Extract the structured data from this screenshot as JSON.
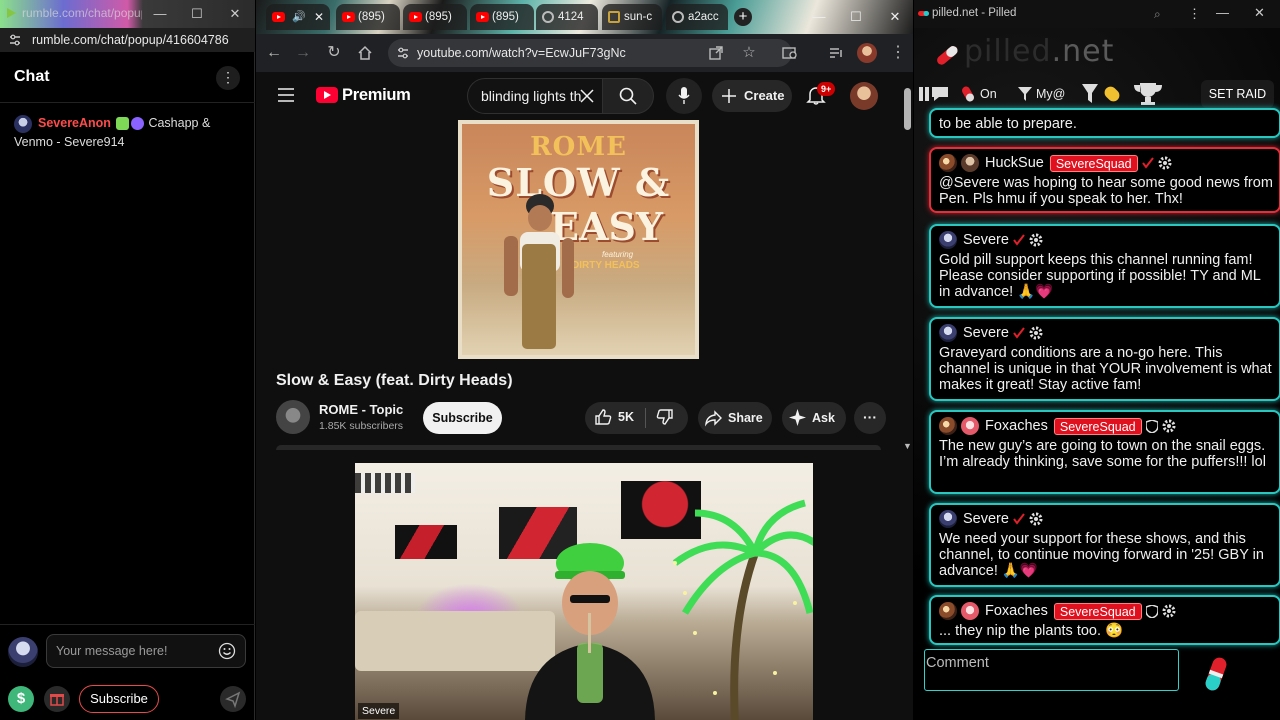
{
  "rumble": {
    "window_title": "rumble.com/chat/popup/41...",
    "url": "rumble.com/chat/popup/416604786",
    "chat_title": "Chat",
    "message": {
      "user": "SevereAnon",
      "text": "Cashapp & Venmo - Severe914"
    },
    "input_placeholder": "Your message here!",
    "subscribe_label": "Subscribe"
  },
  "chrome": {
    "tabs": [
      {
        "label": ""
      },
      {
        "label": "(895)"
      },
      {
        "label": "(895)"
      },
      {
        "label": "(895)"
      },
      {
        "label": "4124"
      },
      {
        "label": "sun-c"
      },
      {
        "label": "a2acc"
      }
    ],
    "url": "youtube.com/watch?v=EcwJuF73gNc",
    "youtube": {
      "brand": "Premium",
      "search_value": "blinding lights th",
      "create_label": "Create",
      "notification_count": "9+",
      "album": {
        "artist": "ROME",
        "line1": "SLOW &",
        "line2": "EASY",
        "featuring": "featuring",
        "feat_artist": "DIRTY HEADS"
      },
      "video_title": "Slow & Easy (feat. Dirty Heads)",
      "channel_name": "ROME - Topic",
      "subscriber_count": "1.85K subscribers",
      "subscribe_label": "Subscribe",
      "like_count": "5K",
      "share_label": "Share",
      "ask_label": "Ask"
    },
    "webcam_label": "Severe"
  },
  "pilled": {
    "window_title": "pilled.net - Pilled",
    "logo": {
      "main": "pilled",
      "tld": ".net"
    },
    "toolbar": {
      "toggle_label": "On",
      "filter_label": "My@",
      "raid_label": "SET RAID"
    },
    "messages": [
      {
        "user": "",
        "text": "to be able to prepare.",
        "partial": true
      },
      {
        "user": "HuckSue",
        "badge": "SevereSquad",
        "text": "@Severe was hoping to hear some good news from Pen. Pls hmu if you speak to her. Thx!",
        "color": "red"
      },
      {
        "user": "Severe",
        "text": "Gold pill support keeps this channel running fam! Please consider supporting if possible! TY and ML in advance! 🙏💗"
      },
      {
        "user": "Severe",
        "text": "Graveyard conditions are a no-go here. This channel is unique in that YOUR involvement is what makes it great! Stay active fam!"
      },
      {
        "user": "Foxaches",
        "badge": "SevereSquad",
        "text": "The new guy’s are going to town on the snail eggs. I’m already thinking, save some for the puffers!!! lol"
      },
      {
        "user": "Severe",
        "text": "We need your support for these shows, and this channel, to continue moving forward in '25! GBY in advance! 🙏💗"
      },
      {
        "user": "Foxaches",
        "badge": "SevereSquad",
        "text": "... they nip the plants too. 😳"
      }
    ],
    "comment_placeholder": "Comment"
  }
}
